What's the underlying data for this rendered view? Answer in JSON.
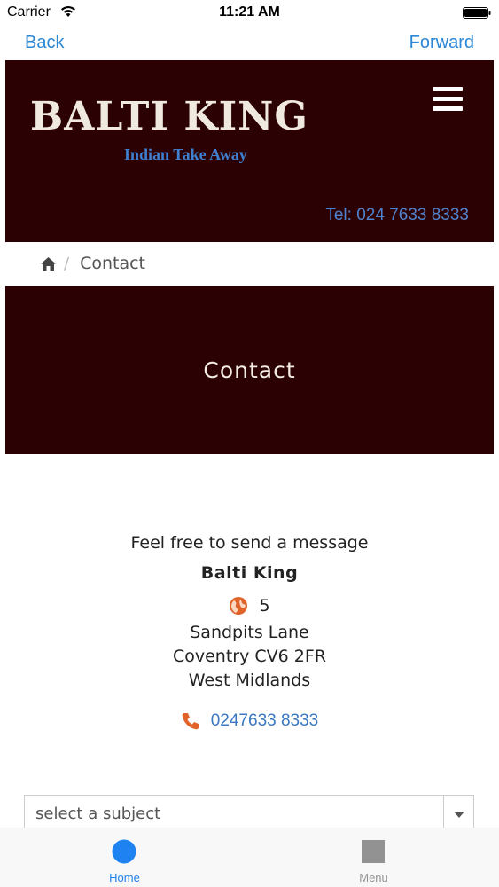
{
  "status_bar": {
    "carrier": "Carrier",
    "time": "11:21 AM"
  },
  "nav": {
    "back_label": "Back",
    "forward_label": "Forward"
  },
  "header": {
    "logo_title": "BALTI KING",
    "logo_subtitle": "Indian Take Away",
    "tel": "Tel: 024 7633 8333",
    "menu_icon": "hamburger-icon"
  },
  "breadcrumb": {
    "home_icon": "home-icon",
    "separator": "/",
    "current": "Contact"
  },
  "banner": {
    "title": "Contact"
  },
  "info": {
    "intro": "Feel free to send a message",
    "name": "Balti King",
    "address_icon": "globe-icon",
    "address_number": "5",
    "address_lines": [
      "Sandpits Lane",
      "Coventry CV6 2FR",
      "West Midlands"
    ],
    "phone_icon": "phone-icon",
    "phone": "0247633 8333"
  },
  "form": {
    "subject_select_value": "select a subject"
  },
  "tab_bar": {
    "tabs": [
      {
        "label": "Home",
        "icon": "circle-icon",
        "active": true
      },
      {
        "label": "Menu",
        "icon": "square-icon",
        "active": false
      }
    ]
  },
  "colors": {
    "banner_bg": "#2c0103",
    "ios_blue": "#2a87d6",
    "logo_text": "#efe9df",
    "logo_subtitle": "#3f7fcf",
    "icon_orange": "#e0632a",
    "tab_active": "#1e82f0"
  }
}
